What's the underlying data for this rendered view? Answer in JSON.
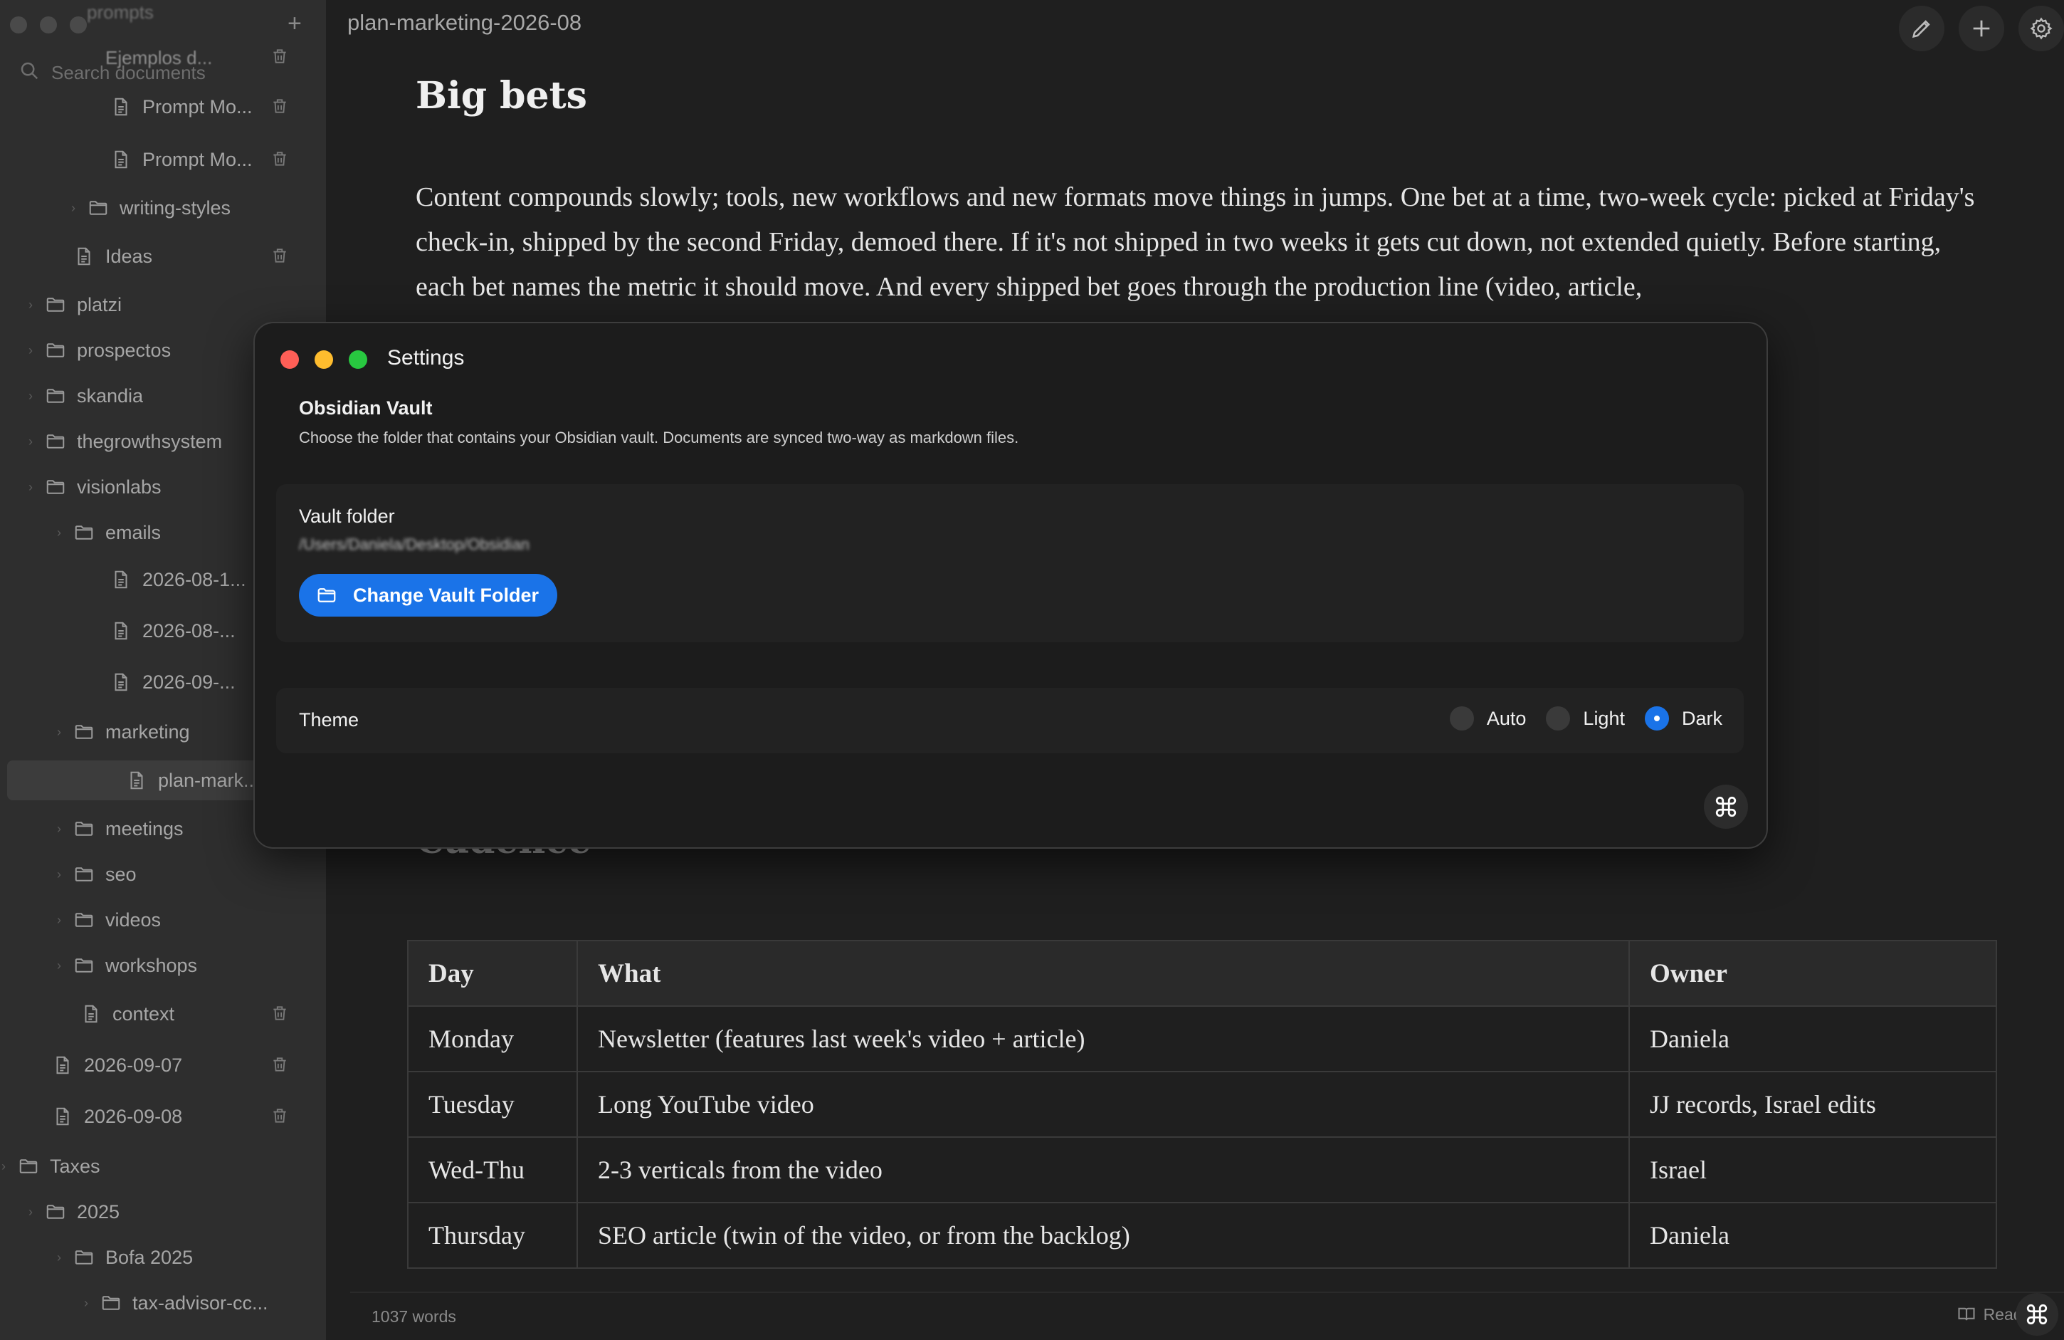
{
  "sidebar": {
    "ghost_top": "prompts",
    "ghost_item": "Ejemplos d...",
    "search_placeholder": "Search documents",
    "items": [
      {
        "label": "Prompt Mo...",
        "type": "file"
      },
      {
        "label": "Prompt Mo...",
        "type": "file"
      },
      {
        "label": "writing-styles",
        "type": "folder"
      },
      {
        "label": "Ideas",
        "type": "file"
      },
      {
        "label": "platzi",
        "type": "folder"
      },
      {
        "label": "prospectos",
        "type": "folder"
      },
      {
        "label": "skandia",
        "type": "folder"
      },
      {
        "label": "thegrowthsystem",
        "type": "folder"
      },
      {
        "label": "visionlabs",
        "type": "folder"
      },
      {
        "label": "emails",
        "type": "folder"
      },
      {
        "label": "2026-08-1...",
        "type": "file"
      },
      {
        "label": "2026-08-...",
        "type": "file"
      },
      {
        "label": "2026-09-...",
        "type": "file"
      },
      {
        "label": "marketing",
        "type": "folder"
      },
      {
        "label": "plan-mark...",
        "type": "file",
        "active": true
      },
      {
        "label": "meetings",
        "type": "folder"
      },
      {
        "label": "seo",
        "type": "folder"
      },
      {
        "label": "videos",
        "type": "folder"
      },
      {
        "label": "workshops",
        "type": "folder"
      },
      {
        "label": "context",
        "type": "file"
      },
      {
        "label": "2026-09-07",
        "type": "file"
      },
      {
        "label": "2026-09-08",
        "type": "file"
      },
      {
        "label": "Taxes",
        "type": "folder"
      },
      {
        "label": "2025",
        "type": "folder"
      },
      {
        "label": "Bofa 2025",
        "type": "folder"
      },
      {
        "label": "tax-advisor-cc...",
        "type": "folder"
      }
    ]
  },
  "editor": {
    "doc_title": "plan-marketing-2026-08",
    "heading1": "Big bets",
    "paragraph": "Content compounds slowly; tools, new workflows and new formats move things in jumps. One bet at a time, two-week cycle: picked at Friday's check-in, shipped by the second Friday, demoed there. If it's not shipped in two weeks it gets cut down, not extended quietly. Before starting, each bet names the metric it should move. And every shipped bet goes through the production line (video, article,",
    "heading2": "Cadence",
    "table": {
      "headers": [
        "Day",
        "What",
        "Owner"
      ],
      "rows": [
        [
          "Monday",
          "Newsletter (features last week's video + article)",
          "Daniela"
        ],
        [
          "Tuesday",
          "Long YouTube video",
          "JJ records, Israel edits"
        ],
        [
          "Wed-Thu",
          "2-3 verticals from the video",
          "Israel"
        ],
        [
          "Thursday",
          "SEO article (twin of the video, or from the backlog)",
          "Daniela"
        ]
      ]
    },
    "word_count": "1037 words",
    "reader_label": "Reader"
  },
  "settings": {
    "window_title": "Settings",
    "section_title": "Obsidian Vault",
    "section_desc": "Choose the folder that contains your Obsidian vault. Documents are synced two-way as markdown files.",
    "vault_label": "Vault folder",
    "vault_path": "/Users/Daniela/Desktop/Obsidian",
    "change_button": "Change Vault Folder",
    "theme_label": "Theme",
    "theme_options": [
      "Auto",
      "Light",
      "Dark"
    ],
    "theme_selected": "Dark"
  },
  "colors": {
    "accent": "#1a73e8",
    "close": "#ff5f57",
    "minimize": "#febc2e",
    "zoom": "#28c840"
  }
}
